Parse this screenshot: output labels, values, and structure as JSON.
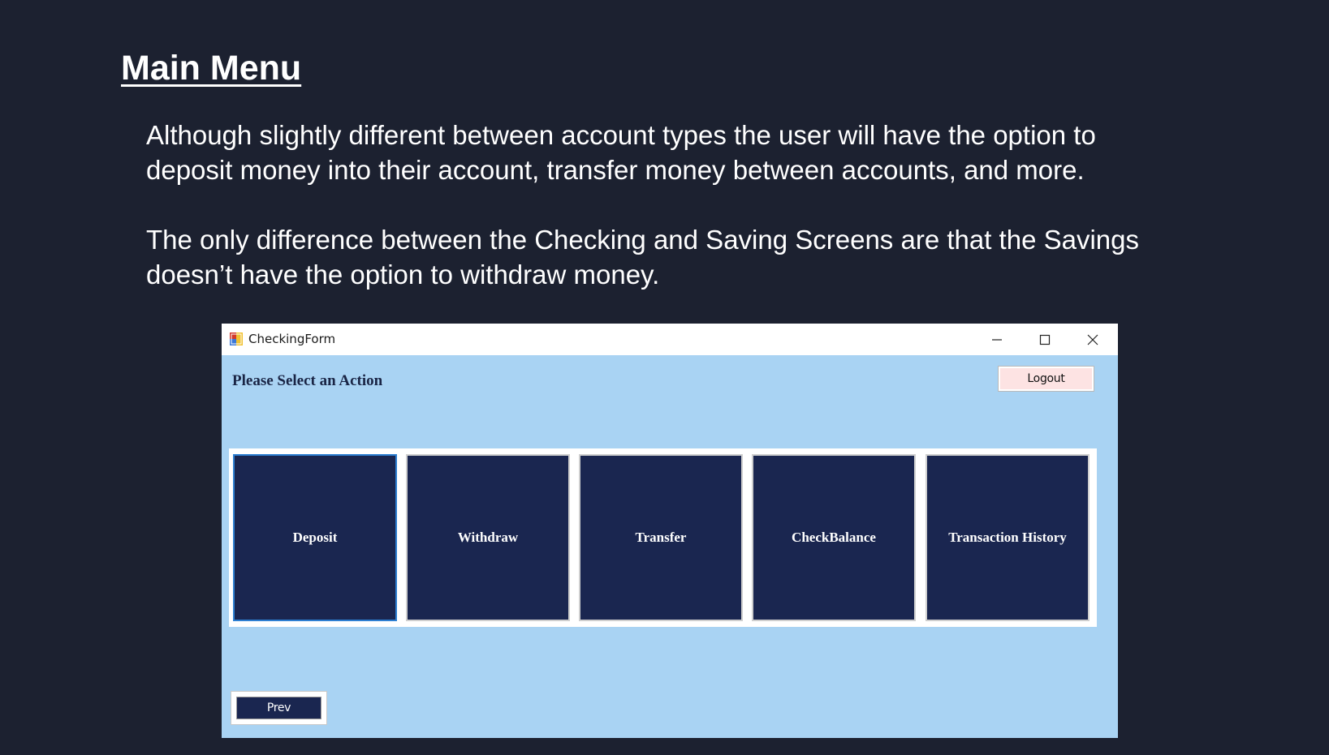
{
  "slide": {
    "title": "Main Menu",
    "paragraph_1": [
      "Although slightly different between account types the user will have the option to",
      "deposit money into their account, transfer money between accounts, and more."
    ],
    "paragraph_2": [
      "The only difference between the Checking and Saving Screens are that the Savings",
      "doesn’t have the option to withdraw money."
    ]
  },
  "window": {
    "title": "CheckingForm",
    "icon": "form-app-icon",
    "controls": {
      "minimize": "minimize-icon",
      "maximize": "maximize-icon",
      "close": "close-icon"
    }
  },
  "form": {
    "heading": "Please Select an Action",
    "logout_label": "Logout",
    "actions": [
      {
        "label": "Deposit"
      },
      {
        "label": "Withdraw"
      },
      {
        "label": "Transfer"
      },
      {
        "label": "CheckBalance"
      },
      {
        "label": "Transaction History"
      }
    ],
    "prev_label": "Prev"
  },
  "colors": {
    "slide_background": "#1c2130",
    "form_background": "#a9d3f3",
    "button_navy": "#1a2650",
    "logout_background": "#fde3e3",
    "focus_border": "#2d7fd2"
  }
}
